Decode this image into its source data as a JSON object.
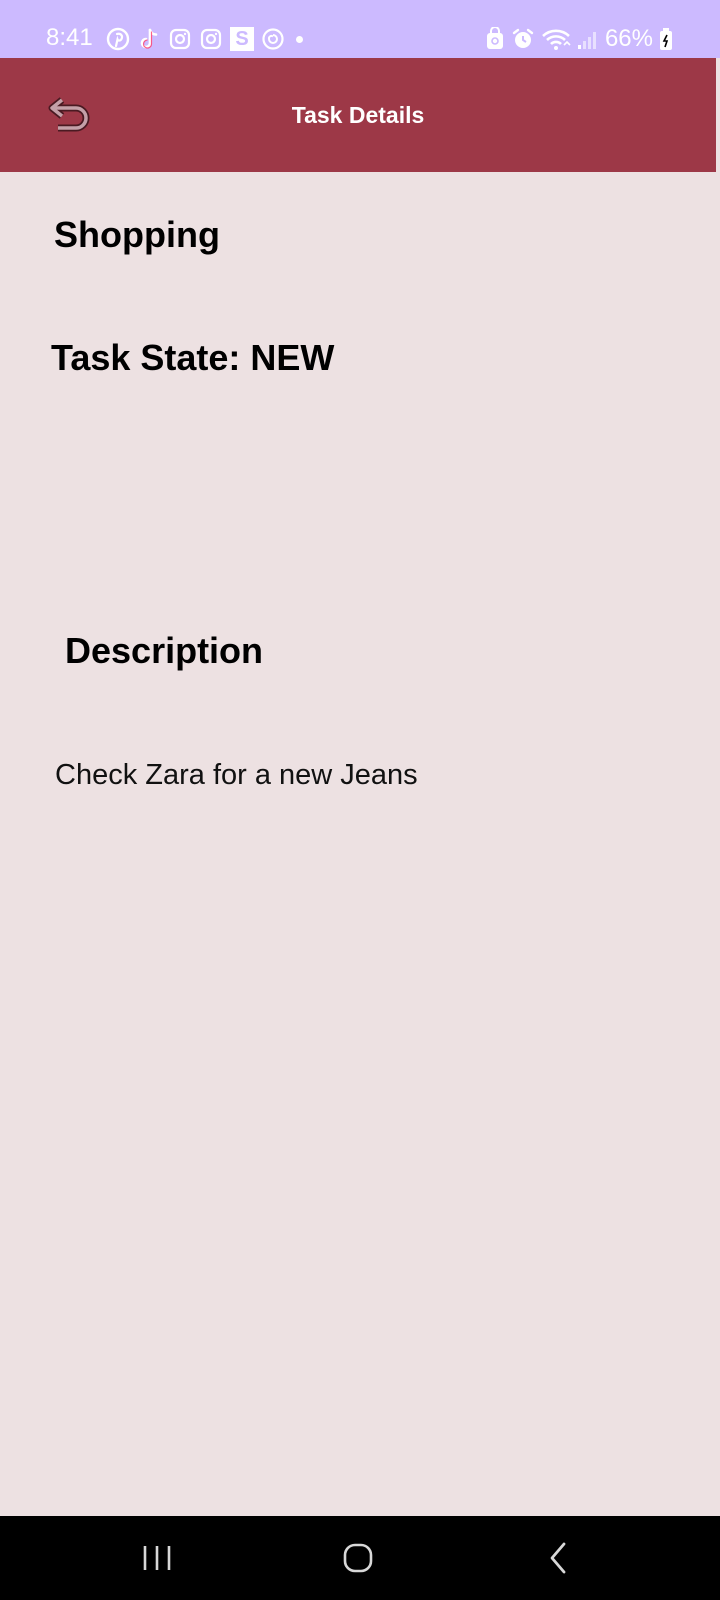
{
  "status_bar": {
    "time": "8:41",
    "battery": "66%",
    "left_icons": [
      "pinterest-icon",
      "tiktok-icon",
      "instagram-icon",
      "instagram-icon",
      "s-app-icon",
      "spiral-app-icon",
      "notification-dot"
    ],
    "s_app_letter": "S",
    "right_icons": [
      "lock-badge-icon",
      "alarm-icon",
      "wifi-icon",
      "signal-icon",
      "battery-icon"
    ],
    "colors": {
      "background": "#ccbaff",
      "foreground": "#ffffff"
    }
  },
  "app_bar": {
    "title": "Task Details",
    "back_icon": "back-arrow-icon",
    "color": "#9d3847"
  },
  "task": {
    "title": "Shopping",
    "state": "Task State: NEW",
    "description_heading": "Description",
    "description": "Check Zara for a new Jeans"
  },
  "nav_bar": {
    "buttons": [
      "recent-apps-icon",
      "home-icon",
      "back-icon"
    ]
  },
  "colors": {
    "page_background": "#ede1e2"
  }
}
